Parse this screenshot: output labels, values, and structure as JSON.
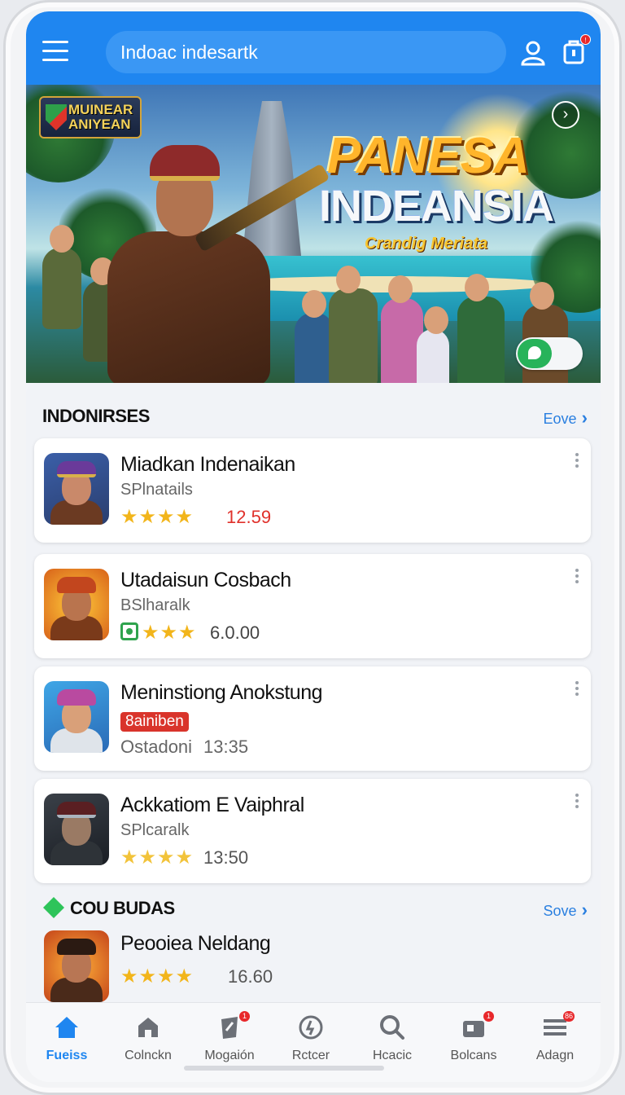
{
  "header": {
    "search_text": "Indoac indesartk",
    "notification_badge": "!",
    "colors": {
      "primary": "#1f86f0"
    }
  },
  "banner": {
    "logo_text": "MUINEAR ANIYEAN",
    "title_line1": "PANESA",
    "title_line2": "INDEANSIA",
    "subtitle": "Crandig Meriata"
  },
  "section1": {
    "title": "INDONIRSES",
    "see_more": "Eove"
  },
  "games": [
    {
      "title": "Miadkan Indenaikan",
      "subtitle": "SPlnatails",
      "stars": "★★★★",
      "rating": "12.59",
      "rating_color": "#e0312b"
    },
    {
      "title": "Utadaisun Cosbach",
      "subtitle": "BSlharalk",
      "stars": "★★★",
      "rating": "6.0.00",
      "rating_color": "#444444"
    },
    {
      "title": "Meninstiong Anokstung",
      "tag": "8ainiben",
      "subtitle": "Ostadoni",
      "time": "13:35"
    },
    {
      "title": "Ackkatiom E Vaiphral",
      "subtitle": "SPlcaralk",
      "stars": "★★★★",
      "rating": "13:50",
      "rating_color": "#555555"
    }
  ],
  "section2": {
    "title": "COU BUDAS",
    "see_more": "Sove",
    "game": {
      "title": "Peooiea Neldang",
      "stars": "★★★★",
      "rating": "16.60"
    }
  },
  "bottom_nav": [
    {
      "label": "Fueiss",
      "icon": "home-icon",
      "active": true
    },
    {
      "label": "Colnckn",
      "icon": "store-icon"
    },
    {
      "label": "Mogaión",
      "icon": "flag-icon",
      "badge": "1"
    },
    {
      "label": "Rctcer",
      "icon": "clock-icon"
    },
    {
      "label": "Hcacic",
      "icon": "search-icon"
    },
    {
      "label": "Bolcans",
      "icon": "camera-icon",
      "badge": "1"
    },
    {
      "label": "Adagn",
      "icon": "menu-icon",
      "badge": "86"
    }
  ]
}
